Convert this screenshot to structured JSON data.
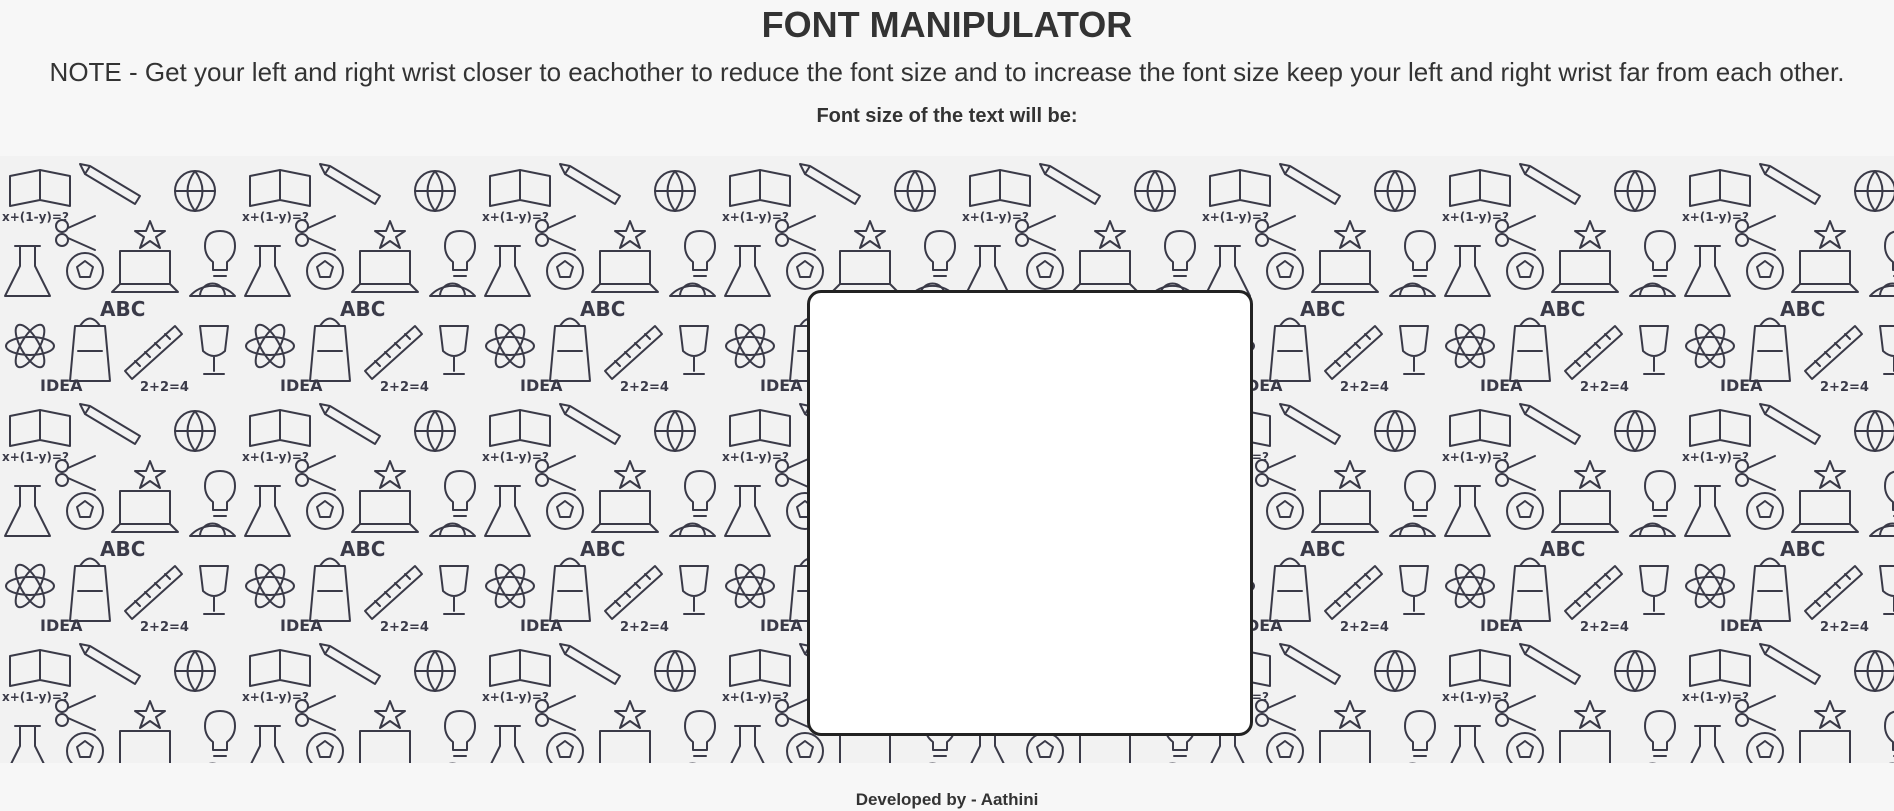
{
  "header": {
    "title": "FONT MANIPULATOR",
    "note": "NOTE - Get your left and right wrist closer to eachother to reduce the font size and to increase the font size keep your left and right wrist far from each other.",
    "font_size_label": "Font size of the text will be:"
  },
  "background": {
    "pattern_texts": [
      "ABC",
      "IDEA",
      "2+2=4",
      "x+(1-y)=?",
      "(1-y)=?"
    ],
    "colors": {
      "page": "#f7f7f7",
      "pattern_bg": "#f2f2f2",
      "pattern_ink": "#3a3a48"
    }
  },
  "footer": {
    "credit": "Developed by - Aathini"
  }
}
